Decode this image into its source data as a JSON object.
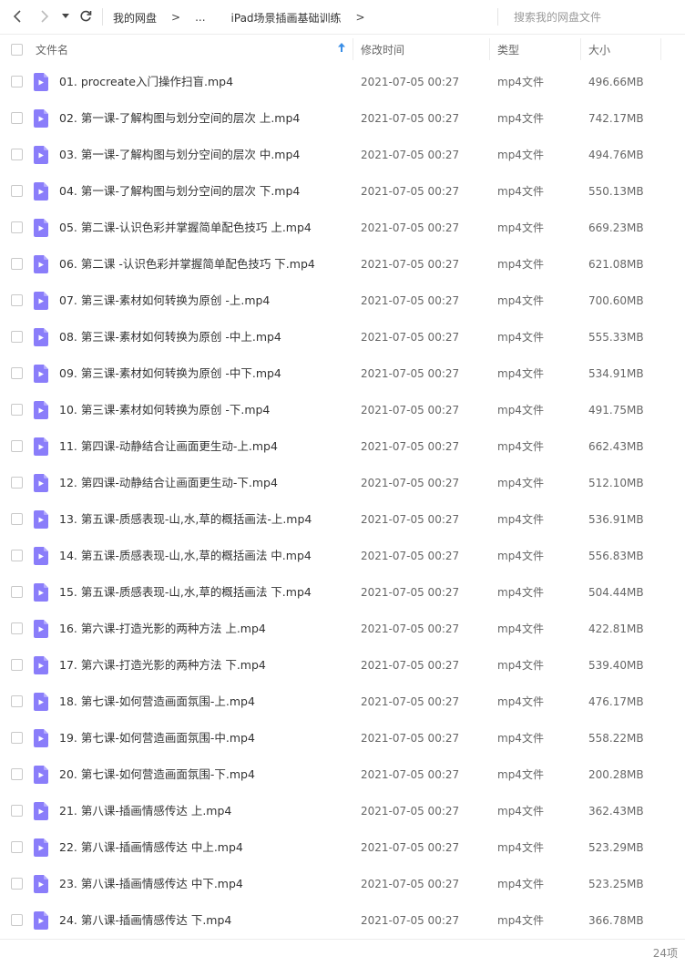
{
  "nav": {
    "back_icon": "chevron-left-icon",
    "forward_icon": "chevron-right-icon",
    "history_icon": "caret-down-icon",
    "refresh_icon": "refresh-icon"
  },
  "breadcrumb": {
    "root": "我的网盘",
    "sep1": ">",
    "more": "...",
    "current": "iPad场景插画基础训练",
    "sep2": ">"
  },
  "search": {
    "placeholder": "搜索我的网盘文件",
    "value": ""
  },
  "columns": {
    "name": "文件名",
    "modified": "修改时间",
    "type": "类型",
    "size": "大小"
  },
  "colors": {
    "file_icon": "#8a7dfa",
    "sort_arrow": "#3a8ee6"
  },
  "files": [
    {
      "name": "01. procreate入门操作扫盲.mp4",
      "modified": "2021-07-05 00:27",
      "type": "mp4文件",
      "size": "496.66MB"
    },
    {
      "name": "02. 第一课-了解构图与划分空间的层次 上.mp4",
      "modified": "2021-07-05 00:27",
      "type": "mp4文件",
      "size": "742.17MB"
    },
    {
      "name": "03. 第一课-了解构图与划分空间的层次 中.mp4",
      "modified": "2021-07-05 00:27",
      "type": "mp4文件",
      "size": "494.76MB"
    },
    {
      "name": "04. 第一课-了解构图与划分空间的层次 下.mp4",
      "modified": "2021-07-05 00:27",
      "type": "mp4文件",
      "size": "550.13MB"
    },
    {
      "name": "05. 第二课-认识色彩并掌握简单配色技巧 上.mp4",
      "modified": "2021-07-05 00:27",
      "type": "mp4文件",
      "size": "669.23MB"
    },
    {
      "name": "06. 第二课 -认识色彩并掌握简单配色技巧 下.mp4",
      "modified": "2021-07-05 00:27",
      "type": "mp4文件",
      "size": "621.08MB"
    },
    {
      "name": "07. 第三课-素材如何转换为原创 -上.mp4",
      "modified": "2021-07-05 00:27",
      "type": "mp4文件",
      "size": "700.60MB"
    },
    {
      "name": "08. 第三课-素材如何转换为原创 -中上.mp4",
      "modified": "2021-07-05 00:27",
      "type": "mp4文件",
      "size": "555.33MB"
    },
    {
      "name": "09. 第三课-素材如何转换为原创 -中下.mp4",
      "modified": "2021-07-05 00:27",
      "type": "mp4文件",
      "size": "534.91MB"
    },
    {
      "name": "10. 第三课-素材如何转换为原创 -下.mp4",
      "modified": "2021-07-05 00:27",
      "type": "mp4文件",
      "size": "491.75MB"
    },
    {
      "name": "11. 第四课-动静结合让画面更生动-上.mp4",
      "modified": "2021-07-05 00:27",
      "type": "mp4文件",
      "size": "662.43MB"
    },
    {
      "name": "12. 第四课-动静结合让画面更生动-下.mp4",
      "modified": "2021-07-05 00:27",
      "type": "mp4文件",
      "size": "512.10MB"
    },
    {
      "name": "13. 第五课-质感表现-山,水,草的概括画法-上.mp4",
      "modified": "2021-07-05 00:27",
      "type": "mp4文件",
      "size": "536.91MB"
    },
    {
      "name": "14. 第五课-质感表现-山,水,草的概括画法 中.mp4",
      "modified": "2021-07-05 00:27",
      "type": "mp4文件",
      "size": "556.83MB"
    },
    {
      "name": "15. 第五课-质感表现-山,水,草的概括画法 下.mp4",
      "modified": "2021-07-05 00:27",
      "type": "mp4文件",
      "size": "504.44MB"
    },
    {
      "name": "16. 第六课-打造光影的两种方法 上.mp4",
      "modified": "2021-07-05 00:27",
      "type": "mp4文件",
      "size": "422.81MB"
    },
    {
      "name": "17. 第六课-打造光影的两种方法 下.mp4",
      "modified": "2021-07-05 00:27",
      "type": "mp4文件",
      "size": "539.40MB"
    },
    {
      "name": "18. 第七课-如何营造画面氛围-上.mp4",
      "modified": "2021-07-05 00:27",
      "type": "mp4文件",
      "size": "476.17MB"
    },
    {
      "name": "19. 第七课-如何营造画面氛围-中.mp4",
      "modified": "2021-07-05 00:27",
      "type": "mp4文件",
      "size": "558.22MB"
    },
    {
      "name": "20. 第七课-如何营造画面氛围-下.mp4",
      "modified": "2021-07-05 00:27",
      "type": "mp4文件",
      "size": "200.28MB"
    },
    {
      "name": "21. 第八课-插画情感传达 上.mp4",
      "modified": "2021-07-05 00:27",
      "type": "mp4文件",
      "size": "362.43MB"
    },
    {
      "name": "22. 第八课-插画情感传达 中上.mp4",
      "modified": "2021-07-05 00:27",
      "type": "mp4文件",
      "size": "523.29MB"
    },
    {
      "name": "23. 第八课-插画情感传达 中下.mp4",
      "modified": "2021-07-05 00:27",
      "type": "mp4文件",
      "size": "523.25MB"
    },
    {
      "name": "24. 第八课-插画情感传达 下.mp4",
      "modified": "2021-07-05 00:27",
      "type": "mp4文件",
      "size": "366.78MB"
    }
  ],
  "footer": {
    "count": "24项"
  }
}
